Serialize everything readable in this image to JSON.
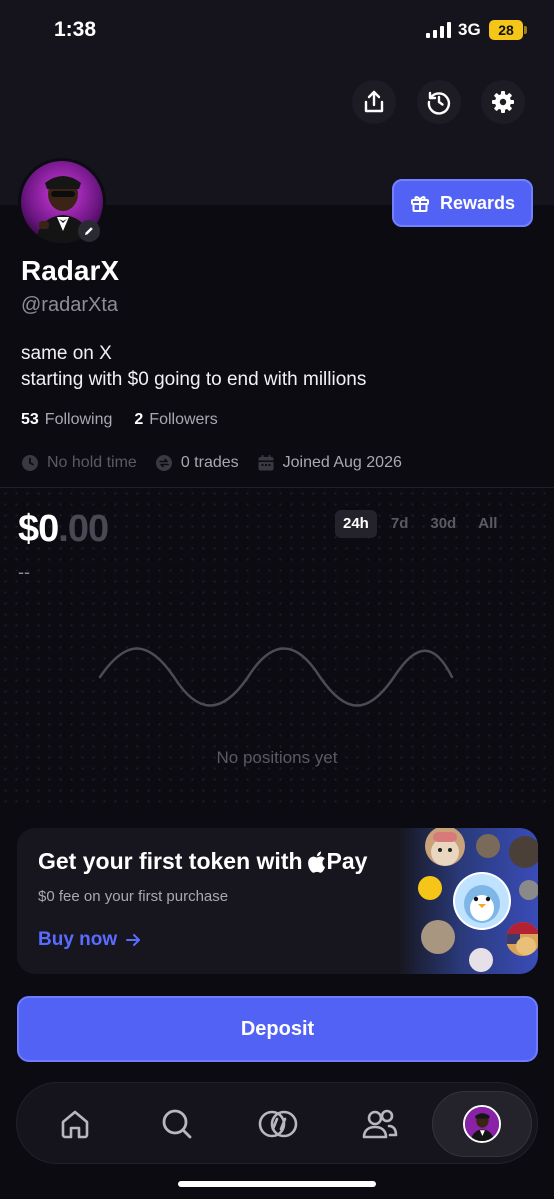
{
  "status_bar": {
    "time": "1:38",
    "network": "3G",
    "battery": "28"
  },
  "profile": {
    "name": "RadarX",
    "handle": "@radarXta",
    "bio_line1": "same on X",
    "bio_line2": "starting with $0 going to end with millions",
    "following_count": "53",
    "following_label": "Following",
    "followers_count": "2",
    "followers_label": "Followers",
    "hold_time": "No hold time",
    "trades": "0 trades",
    "joined": "Joined Aug 2026",
    "rewards_label": "Rewards"
  },
  "portfolio": {
    "balance_whole": "$0",
    "balance_cents": ".00",
    "change": "--",
    "ranges": [
      "24h",
      "7d",
      "30d",
      "All"
    ],
    "active_range": "24h",
    "empty_text": "No positions yet"
  },
  "promo": {
    "title": "Get your first token with",
    "pay_word": "Pay",
    "subtitle": "$0 fee on your first purchase",
    "cta": "Buy now"
  },
  "deposit_label": "Deposit",
  "nav": [
    "home",
    "search",
    "trade",
    "social",
    "profile"
  ],
  "colors": {
    "accent": "#5262f5",
    "background": "#0c0b12",
    "link": "#5a6cff"
  }
}
